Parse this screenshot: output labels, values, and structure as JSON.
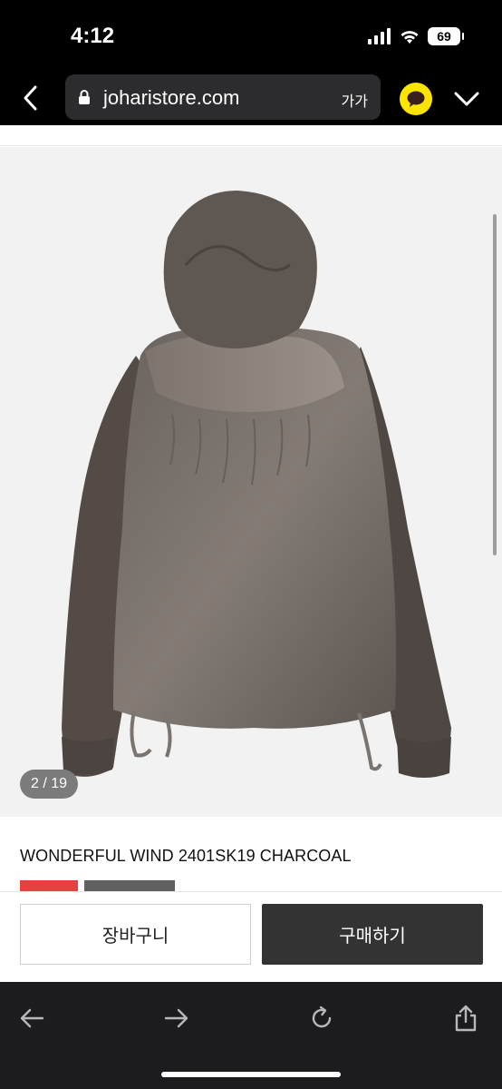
{
  "status": {
    "time": "4:12",
    "battery": "69"
  },
  "browser": {
    "url": "joharistore.com",
    "text_size_label": "가가"
  },
  "gallery": {
    "counter": "2 / 19",
    "image_alt": "Back view of hooded wind jacket"
  },
  "product": {
    "title": "WONDERFUL WIND 2401SK19 CHARCOAL"
  },
  "actions": {
    "cart_label": "장바구니",
    "buy_label": "구매하기"
  },
  "colors": {
    "sale_badge": "#e74040",
    "buy_button": "#333333",
    "kakao": "#fee500"
  },
  "icons": [
    "chevron-left-icon",
    "lock-icon",
    "kakao-talk-icon",
    "chevron-down-icon",
    "arrow-left-icon",
    "arrow-right-icon",
    "reload-icon",
    "share-icon"
  ]
}
